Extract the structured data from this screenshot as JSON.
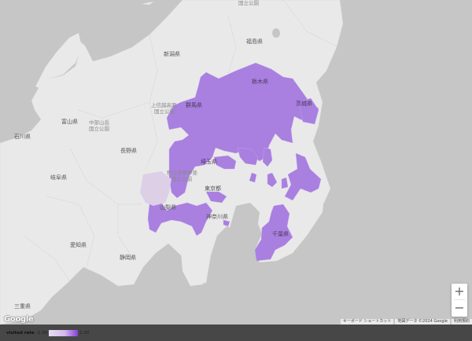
{
  "map": {
    "prefecture_labels": {
      "niigata": "新潟県",
      "fukushima": "福島県",
      "toyama": "富山県",
      "ishikawa": "石川県",
      "nagano": "長野県",
      "gifu": "岐阜県",
      "aichi": "愛知県",
      "shizuoka": "静岡県",
      "mie": "三重県",
      "gunma": "群馬県",
      "tochigi": "栃木県",
      "ibaraki": "茨城県",
      "saitama": "埼玉県",
      "tokyo": "東京都",
      "yamanashi": "山梨県",
      "kanagawa": "神奈川県",
      "chiba": "千葉県"
    },
    "park_labels": {
      "top": "国立公園",
      "joshinetsu_1": "上信越高原",
      "joshinetsu_2": "国立公園",
      "chubu_1": "中部山岳",
      "chubu_2": "国立公園",
      "chichibu_1": "秩父多摩甲斐",
      "chichibu_2": "国立公園"
    },
    "colors": {
      "land": "#e9e9e9",
      "sea": "#c6c6c6",
      "visited": "#a97fe0",
      "partial": "#dccfe6"
    }
  },
  "controls": {
    "zoom_in": "+",
    "zoom_out": "−"
  },
  "google_logo": "Google",
  "attribution": {
    "shortcuts": "キーボード ショートカット",
    "map_data": "地図データ ©2024 Google",
    "terms": "利用規約"
  },
  "legend": {
    "title": "visited rate",
    "min": "-1.00",
    "max": "1.00",
    "gradient_start": "#e6dded",
    "gradient_end": "#8a3ed8"
  }
}
